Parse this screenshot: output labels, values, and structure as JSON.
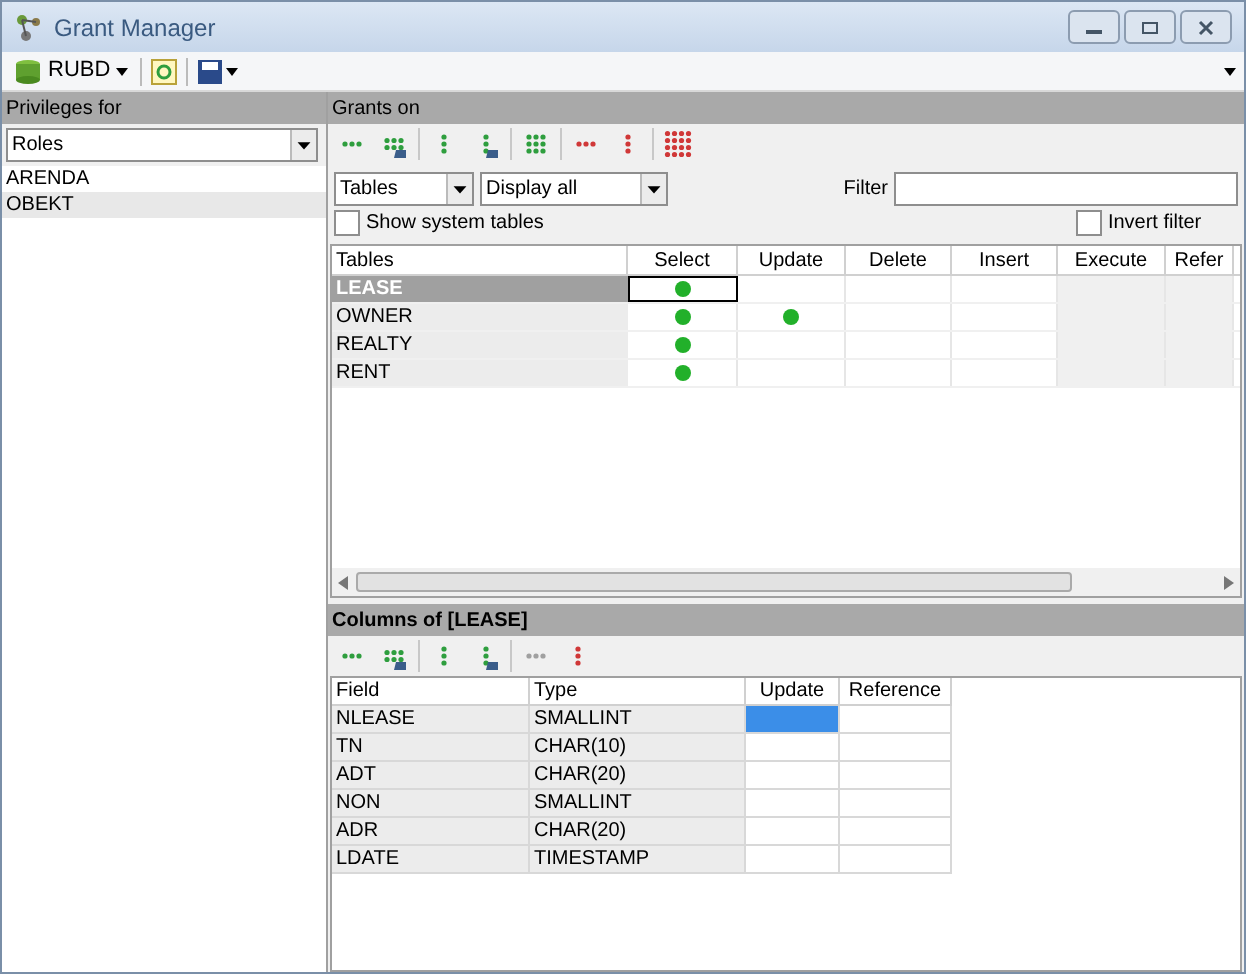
{
  "window": {
    "title": "Grant Manager"
  },
  "toolbar": {
    "database": "RUBD"
  },
  "privileges_panel": {
    "header": "Privileges for",
    "combo": "Roles",
    "items": [
      {
        "label": "ARENDA",
        "selected": false
      },
      {
        "label": "OBEKT",
        "selected": true
      }
    ]
  },
  "grants_panel": {
    "header": "Grants on",
    "toolbar": [
      {
        "kind": "grant-all-row",
        "disabled": false
      },
      {
        "kind": "grant-all-row-option",
        "disabled": false
      },
      {
        "kind": "grant-all-column",
        "disabled": false
      },
      {
        "kind": "grant-all-column-option",
        "disabled": false
      },
      {
        "kind": "grant-all",
        "disabled": false
      },
      {
        "kind": "revoke-row",
        "disabled": false
      },
      {
        "kind": "revoke-column",
        "disabled": false
      },
      {
        "kind": "revoke-all",
        "disabled": false
      }
    ],
    "object_type": "Tables",
    "display": "Display all",
    "filter_label": "Filter",
    "show_system_tables": {
      "label": "Show system tables",
      "checked": false
    },
    "invert_filter": {
      "label": "Invert filter",
      "checked": false
    },
    "table": {
      "columns": [
        "Tables",
        "Select",
        "Update",
        "Delete",
        "Insert",
        "Execute",
        "Refer"
      ],
      "rows": [
        {
          "name": "LEASE",
          "selected": true,
          "grants": [
            true,
            false,
            false,
            false,
            false,
            false
          ]
        },
        {
          "name": "OWNER",
          "selected": false,
          "grants": [
            true,
            true,
            false,
            false,
            false,
            false
          ]
        },
        {
          "name": "REALTY",
          "selected": false,
          "grants": [
            true,
            false,
            false,
            false,
            false,
            false
          ]
        },
        {
          "name": "RENT",
          "selected": false,
          "grants": [
            true,
            false,
            false,
            false,
            false,
            false
          ]
        }
      ]
    }
  },
  "columns_panel": {
    "header": "Columns of [LEASE]",
    "toolbar": [
      {
        "kind": "grant-all-row",
        "disabled": false
      },
      {
        "kind": "grant-all-row-option",
        "disabled": false
      },
      {
        "kind": "grant-all-column",
        "disabled": false
      },
      {
        "kind": "grant-all-column-option",
        "disabled": false
      },
      {
        "kind": "revoke-row",
        "disabled": true
      },
      {
        "kind": "revoke-column",
        "disabled": false
      }
    ],
    "table": {
      "columns": [
        "Field",
        "Type",
        "Update",
        "Reference"
      ],
      "rows": [
        {
          "field": "NLEASE",
          "type": "SMALLINT",
          "selected": true
        },
        {
          "field": "TN",
          "type": "CHAR(10)",
          "selected": false
        },
        {
          "field": "ADT",
          "type": "CHAR(20)",
          "selected": false
        },
        {
          "field": "NON",
          "type": "SMALLINT",
          "selected": false
        },
        {
          "field": "ADR",
          "type": "CHAR(20)",
          "selected": false
        },
        {
          "field": "LDATE",
          "type": "TIMESTAMP",
          "selected": false
        }
      ]
    }
  }
}
